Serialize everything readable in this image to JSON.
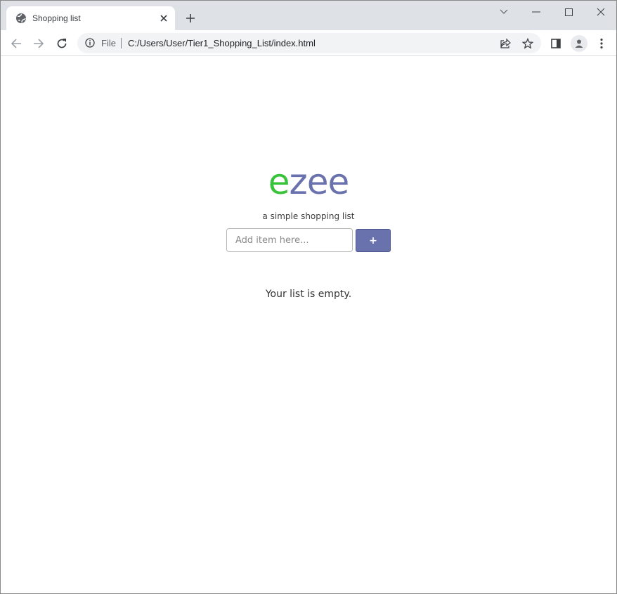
{
  "browser": {
    "tab_title": "Shopping list",
    "address_scheme_label": "File",
    "address_url": "C:/Users/User/Tier1_Shopping_List/index.html"
  },
  "page": {
    "logo_first": "e",
    "logo_rest": "zee",
    "tagline": "a simple shopping list",
    "input_placeholder": "Add item here...",
    "input_value": "",
    "add_button_label": "+",
    "empty_message": "Your list is empty."
  },
  "colors": {
    "logo_green": "#39c33b",
    "accent_purple": "#6a72ad"
  },
  "icons": {
    "tab_favicon": "globe-icon",
    "tab_close": "close-icon",
    "new_tab": "plus-icon",
    "back": "back-arrow-icon",
    "forward": "forward-arrow-icon",
    "reload": "reload-icon",
    "site_info": "info-icon",
    "share": "share-icon",
    "bookmark": "star-icon",
    "side_panel": "side-panel-icon",
    "profile": "profile-icon",
    "menu": "kebab-menu-icon"
  }
}
